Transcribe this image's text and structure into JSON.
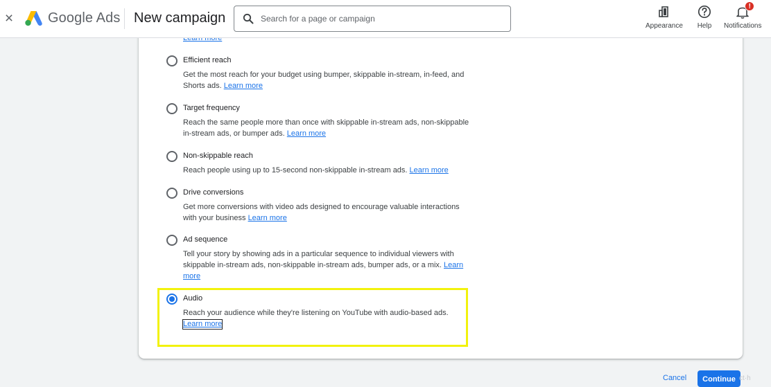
{
  "header": {
    "close_label": "×",
    "brand_google": "Google",
    "brand_ads": "Ads",
    "page_title": "New campaign",
    "search_placeholder": "Search for a page or campaign",
    "actions": [
      {
        "label": "Appearance",
        "icon": "appearance-icon"
      },
      {
        "label": "Help",
        "icon": "help-icon"
      },
      {
        "label": "Notifications",
        "icon": "notifications-icon",
        "badge": "!"
      }
    ]
  },
  "content": {
    "top_learn_more": "Learn more",
    "options": [
      {
        "title": "Efficient reach",
        "description": "Get the most reach for your budget using bumper, skippable in-stream, in-feed, and Shorts ads.",
        "link": "Learn more",
        "selected": false
      },
      {
        "title": "Target frequency",
        "description": "Reach the same people more than once with skippable in-stream ads, non-skippable in-stream ads, or bumper ads.",
        "link": "Learn more",
        "selected": false
      },
      {
        "title": "Non-skippable reach",
        "description": "Reach people using up to 15-second non-skippable in-stream ads.",
        "link": "Learn more",
        "selected": false
      },
      {
        "title": "Drive conversions",
        "description": "Get more conversions with video ads designed to encourage valuable interactions with your business",
        "link": "Learn more",
        "selected": false
      },
      {
        "title": "Ad sequence",
        "description": "Tell your story by showing ads in a particular sequence to individual viewers with skippable in-stream ads, non-skippable in-stream ads, bumper ads, or a mix.",
        "link": "Learn more",
        "selected": false
      },
      {
        "title": "Audio",
        "description": "Reach your audience while they're listening on YouTube with audio-based ads.",
        "link": "Learn more",
        "selected": true
      }
    ]
  },
  "footer": {
    "cancel_label": "Cancel",
    "continue_label": "Continue",
    "faded_label": "ct·h"
  },
  "colors": {
    "accent": "#1a73e8",
    "highlight": "#f2f20c",
    "badge": "#d93025"
  }
}
